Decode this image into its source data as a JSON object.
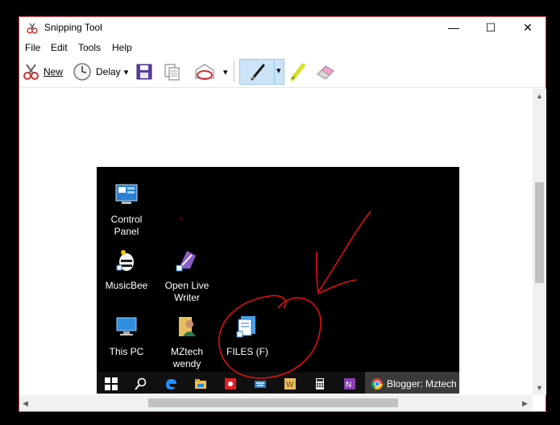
{
  "window": {
    "title": "Snipping Tool",
    "minimize_glyph": "—",
    "maximize_glyph": "☐",
    "close_glyph": "✕"
  },
  "menu": {
    "file": "File",
    "edit": "Edit",
    "tools": "Tools",
    "help": "Help"
  },
  "toolbar": {
    "new_label": "New",
    "delay_label": "Delay",
    "icons": [
      "scissors-icon",
      "clock-icon",
      "save-icon",
      "copy-icon",
      "send-snip-icon",
      "pen-icon",
      "highlighter-icon",
      "eraser-icon"
    ],
    "dropdown_glyph": "▾"
  },
  "snip": {
    "desktop_icons": [
      {
        "name": "control-panel",
        "label_1": "Control",
        "label_2": "Panel"
      },
      {
        "name": "musicbee",
        "label_1": "MusicBee",
        "label_2": ""
      },
      {
        "name": "open-live-writer",
        "label_1": "Open Live",
        "label_2": "Writer"
      },
      {
        "name": "this-pc",
        "label_1": "This PC",
        "label_2": ""
      },
      {
        "name": "mztech-wendy",
        "label_1": "MZtech",
        "label_2": "wendy"
      },
      {
        "name": "files-f",
        "label_1": "FILES (F)",
        "label_2": ""
      }
    ],
    "taskbar": {
      "chrome_task_label": "Blogger: Mztech"
    },
    "annotation_color": "#e01010"
  },
  "colors": {
    "window_border": "#c0323c",
    "pen_highlight": "#cce4f7",
    "desktop": "#000000"
  }
}
